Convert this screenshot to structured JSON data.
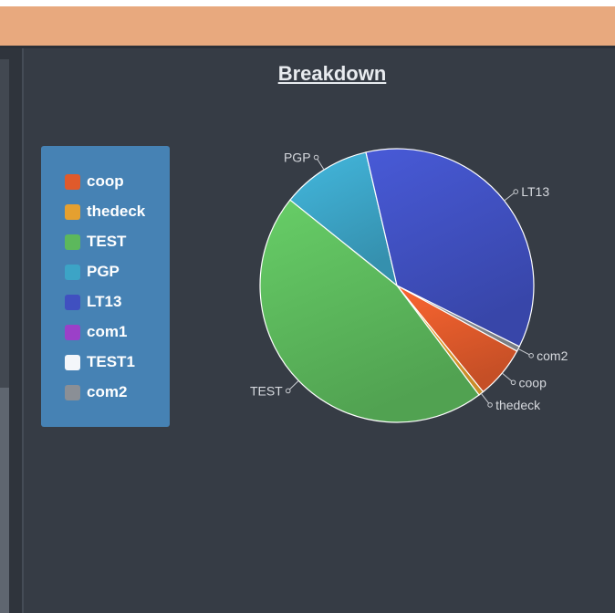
{
  "chart_data": {
    "type": "pie",
    "title": "Breakdown",
    "slices": [
      {
        "label": "coop",
        "value": 6.2,
        "color": "#e05a2b"
      },
      {
        "label": "thedeck",
        "value": 0.6,
        "color": "#e5a030"
      },
      {
        "label": "TEST",
        "value": 46.0,
        "color": "#5cb85c"
      },
      {
        "label": "PGP",
        "value": 10.6,
        "color": "#3ca4c6"
      },
      {
        "label": "LT13",
        "value": 36.0,
        "color": "#4050c0"
      },
      {
        "label": "com1",
        "value": 0.0,
        "color": "#9b40c8"
      },
      {
        "label": "TEST1",
        "value": 0.0,
        "color": "#f4f6fa"
      },
      {
        "label": "com2",
        "value": 0.6,
        "color": "#8a8f96"
      }
    ],
    "legend_position": "left"
  }
}
